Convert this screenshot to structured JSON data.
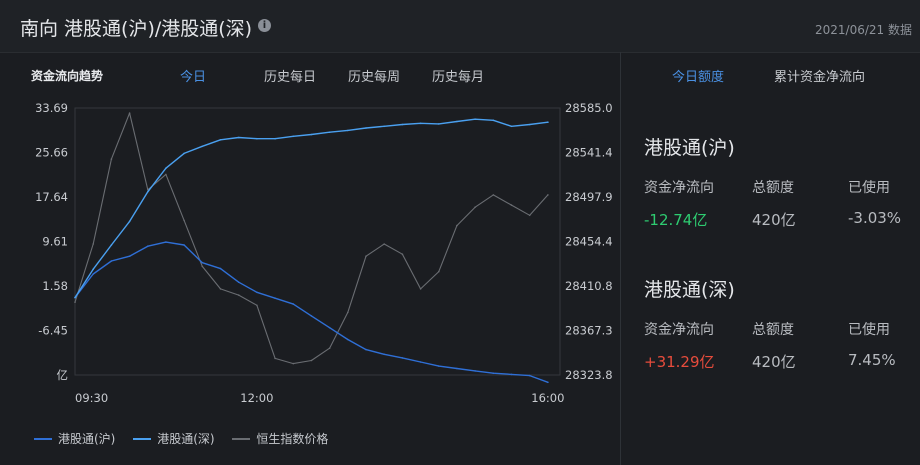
{
  "header": {
    "title": "南向 港股通(沪)/港股通(深)",
    "info_icon": "info-icon",
    "date": "2021/06/21 数据"
  },
  "chart_panel": {
    "heading": "资金流向趋势",
    "tabs": [
      "今日",
      "历史每日",
      "历史每周",
      "历史每月"
    ],
    "active_tab": "今日"
  },
  "right_panel": {
    "tabs": [
      "今日额度",
      "累计资金净流向"
    ],
    "active_tab": "今日额度",
    "sections": [
      {
        "title": "港股通(沪)",
        "labels": [
          "资金净流向",
          "总额度",
          "已使用"
        ],
        "net_flow": "-12.74亿",
        "quota": "420亿",
        "used": "-3.03%"
      },
      {
        "title": "港股通(深)",
        "labels": [
          "资金净流向",
          "总额度",
          "已使用"
        ],
        "net_flow": "+31.29亿",
        "quota": "420亿",
        "used": "7.45%"
      }
    ]
  },
  "colors": {
    "sh_series": "#2f6fd6",
    "sz_series": "#4aa0f0",
    "hsi_series": "#6a6d72",
    "negative": "#2ecc71",
    "positive": "#e74c3c",
    "accent": "#4a90e2"
  },
  "chart_data": {
    "type": "line",
    "title": "资金流向趋势",
    "x_ticks": [
      "09:30",
      "12:00",
      "16:00"
    ],
    "y_left_ticks": [
      "33.69",
      "25.66",
      "17.64",
      "9.61",
      "1.58",
      "-6.45"
    ],
    "y_left_unit": "亿",
    "y_left_range": [
      -11.5,
      33.69
    ],
    "y_right_ticks": [
      "28585.0",
      "28541.4",
      "28497.9",
      "28454.4",
      "28410.8",
      "28367.3",
      "28323.8"
    ],
    "y_right_range": [
      28323.8,
      28585.0
    ],
    "legend": [
      "港股通(沪)",
      "港股通(深)",
      "恒生指数价格"
    ],
    "series": [
      {
        "name": "港股通(沪)",
        "axis": "left",
        "x": [
          "09:30",
          "09:45",
          "10:00",
          "10:15",
          "10:30",
          "10:45",
          "11:00",
          "11:15",
          "11:30",
          "11:45",
          "12:00",
          "12:15",
          "12:30",
          "12:45",
          "13:00",
          "13:15",
          "13:30",
          "13:45",
          "14:00",
          "14:15",
          "14:30",
          "14:45",
          "15:00",
          "15:15",
          "15:30",
          "15:45",
          "16:00"
        ],
        "values": [
          1.6,
          5.6,
          7.8,
          8.6,
          10.3,
          11.0,
          10.5,
          7.5,
          6.5,
          4.2,
          2.5,
          1.5,
          0.5,
          -1.5,
          -3.5,
          -5.5,
          -7.2,
          -8.0,
          -8.6,
          -9.3,
          -10.0,
          -10.4,
          -10.8,
          -11.2,
          -11.4,
          -11.6,
          -12.74
        ]
      },
      {
        "name": "港股通(深)",
        "axis": "left",
        "x": [
          "09:30",
          "09:45",
          "10:00",
          "10:15",
          "10:30",
          "10:45",
          "11:00",
          "11:15",
          "11:30",
          "11:45",
          "12:00",
          "12:15",
          "12:30",
          "12:45",
          "13:00",
          "13:15",
          "13:30",
          "13:45",
          "14:00",
          "14:15",
          "14:30",
          "14:45",
          "15:00",
          "15:15",
          "15:30",
          "15:45",
          "16:00"
        ],
        "values": [
          1.6,
          6.4,
          10.5,
          14.5,
          19.5,
          23.5,
          26.0,
          27.2,
          28.3,
          28.7,
          28.5,
          28.5,
          28.9,
          29.2,
          29.6,
          29.9,
          30.3,
          30.6,
          30.9,
          31.1,
          31.0,
          31.4,
          31.8,
          31.6,
          30.6,
          30.9,
          31.29
        ]
      },
      {
        "name": "恒生指数价格",
        "axis": "right",
        "x": [
          "09:30",
          "09:45",
          "10:00",
          "10:15",
          "10:30",
          "10:45",
          "11:00",
          "11:15",
          "11:30",
          "11:45",
          "12:00",
          "12:15",
          "12:30",
          "12:45",
          "13:00",
          "13:15",
          "13:30",
          "13:45",
          "14:00",
          "14:15",
          "14:30",
          "14:45",
          "15:00",
          "15:15",
          "15:30",
          "15:45",
          "16:00"
        ],
        "values": [
          28395,
          28452,
          28535,
          28580,
          28505,
          28520,
          28475,
          28430,
          28408,
          28402,
          28392,
          28340,
          28335,
          28338,
          28350,
          28385,
          28440,
          28452,
          28442,
          28408,
          28425,
          28470,
          28488,
          28500,
          28490,
          28480,
          28500
        ]
      }
    ]
  }
}
